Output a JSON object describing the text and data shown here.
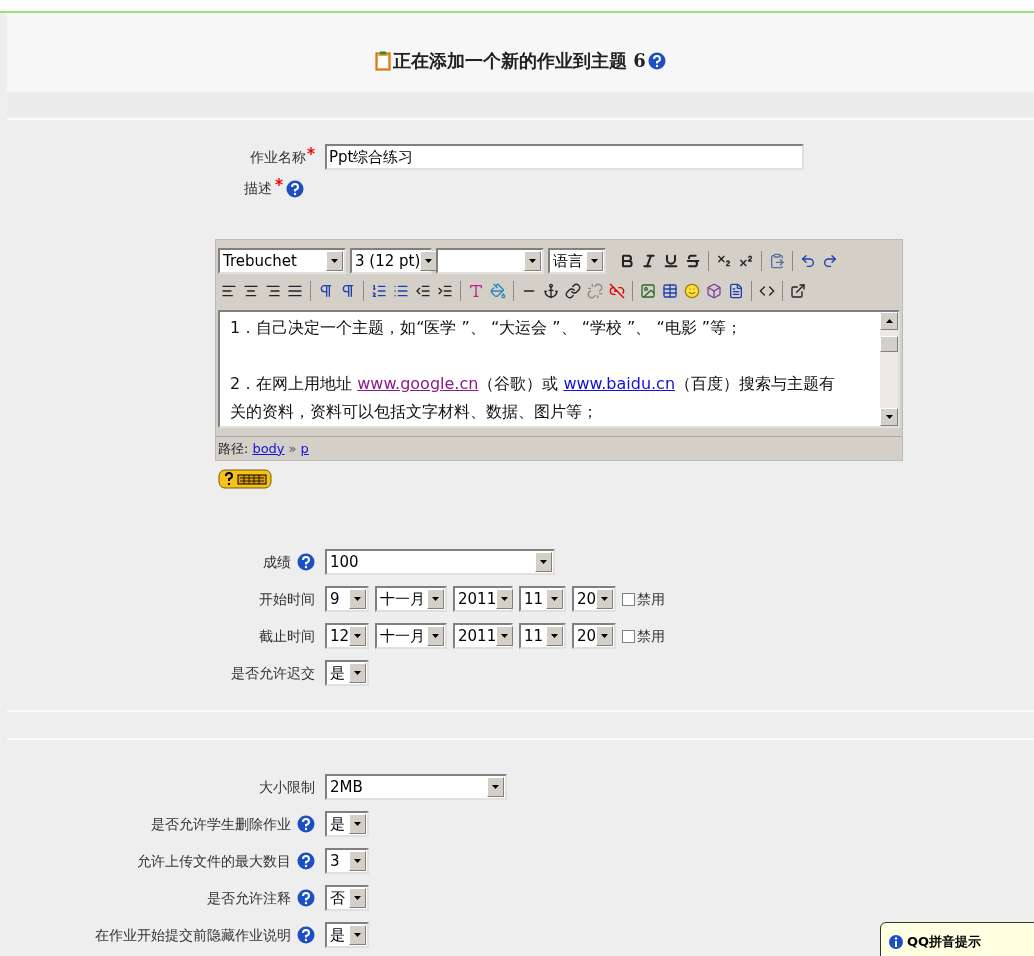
{
  "header": {
    "title": "正在添加一个新的作业到主题 6",
    "help": true
  },
  "name_field": {
    "label": "作业名称",
    "required": true,
    "value": "Ppt综合练习"
  },
  "description": {
    "label": "描述",
    "required": true,
    "help": true
  },
  "editor": {
    "font": "Trebuchet",
    "size": "3 (12 pt)",
    "language": "语言",
    "paragraphs": [
      [
        {
          "kind": "text",
          "text": "1．自己决定一个主题，如“医学 ”、 “大运会 ”、 “学校 ”、 “电影 ”等；"
        }
      ],
      [
        {
          "kind": "text",
          "text": "2．在网上用地址 "
        },
        {
          "kind": "visited_link",
          "text": "www.google.cn"
        },
        {
          "kind": "text",
          "text": "（谷歌）或 "
        },
        {
          "kind": "link",
          "text": "www.baidu.cn"
        },
        {
          "kind": "text",
          "text": "（百度）搜索与主题有关的资料，资料可以包括文字材料、数据、图片等；"
        }
      ]
    ],
    "path_label": "路径:",
    "path": [
      "body",
      "p"
    ],
    "path_sep": "»"
  },
  "rows": [
    {
      "kind": "select",
      "label": "成绩",
      "help": true,
      "value": "100"
    },
    {
      "kind": "datetime",
      "label": "开始时间",
      "help": false,
      "values": [
        "9",
        "十一月",
        "2011",
        "11",
        "20"
      ],
      "disable_label": "禁用",
      "disabled": false
    },
    {
      "kind": "datetime",
      "label": "截止时间",
      "help": false,
      "values": [
        "12",
        "十一月",
        "2011",
        "11",
        "20"
      ],
      "disable_label": "禁用",
      "disabled": false
    },
    {
      "kind": "select",
      "label": "是否允许迟交",
      "help": false,
      "value": "是"
    }
  ],
  "rows2": [
    {
      "kind": "select",
      "label": "大小限制",
      "help": false,
      "value": "2MB"
    },
    {
      "kind": "select",
      "label": "是否允许学生删除作业",
      "help": true,
      "value": "是"
    },
    {
      "kind": "select",
      "label": "允许上传文件的最大数目",
      "help": true,
      "value": "3"
    },
    {
      "kind": "select",
      "label": "是否允许注释",
      "help": true,
      "value": "否"
    },
    {
      "kind": "select",
      "label": "在作业开始提交前隐藏作业说明",
      "help": true,
      "value": "是"
    }
  ],
  "popup": {
    "title": "QQ拼音提示"
  }
}
